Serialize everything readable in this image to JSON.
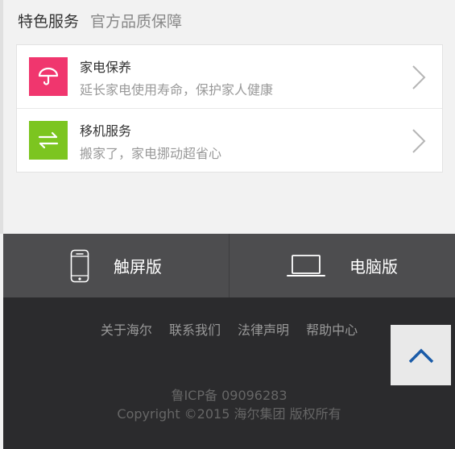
{
  "section": {
    "title": "特色服务",
    "subtitle": "官方品质保障"
  },
  "services": [
    {
      "title": "家电保养",
      "desc": "延长家电使用寿命，保护家人健康",
      "icon": "umbrella-icon",
      "color": "#f0366e"
    },
    {
      "title": "移机服务",
      "desc": "搬家了，家电挪动超省心",
      "icon": "swap-arrows-icon",
      "color": "#7cc520"
    }
  ],
  "switch": {
    "touch_label": "触屏版",
    "pc_label": "电脑版"
  },
  "footer": {
    "links": [
      "关于海尔",
      "联系我们",
      "法律声明",
      "帮助中心"
    ],
    "icp": "鲁ICP备 09096283",
    "copyright": "Copyright ©2015 海尔集团 版权所有"
  },
  "colors": {
    "back_top_arrow": "#1a5ba8",
    "switch_bg": "#4d4d4f",
    "footer_bg": "#2b2b2d"
  }
}
